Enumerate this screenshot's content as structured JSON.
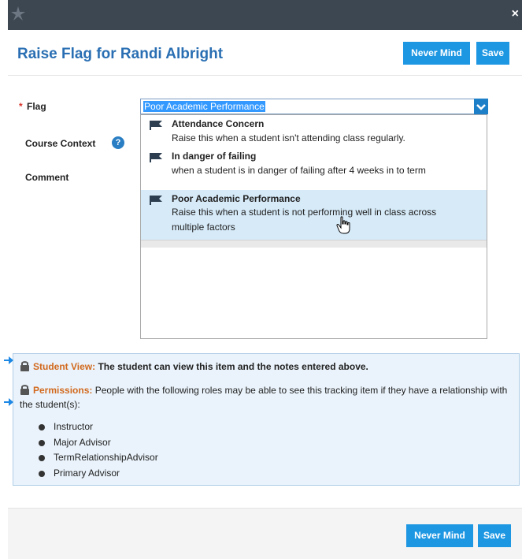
{
  "titlebar": {
    "close_label": "×"
  },
  "dialog": {
    "title": "Raise Flag for Randi Albright",
    "never_mind_label": "Never Mind",
    "save_label": "Save"
  },
  "form": {
    "required_marker": "*",
    "flag_label": "Flag",
    "course_context_label": "Course Context",
    "help_glyph": "?",
    "comment_label": "Comment",
    "flag_selected": "Poor Academic Performance"
  },
  "flag_options": [
    {
      "name": "Attendance Concern",
      "description": "Raise this when a student isn't attending class regularly."
    },
    {
      "name": "In danger of failing",
      "description": "when a student is in danger of failing after 4 weeks in to term"
    },
    {
      "name": "Poor Academic Performance",
      "description": "Raise this when a student is not performing well in class across",
      "description_line2": "multiple factors"
    }
  ],
  "info": {
    "student_view_label": "Student View:",
    "student_view_text": "The student can view this item and the notes entered above.",
    "permissions_label": "Permissions:",
    "permissions_text": "People with the following roles may be able to see this tracking item if they have a relationship with the student(s):",
    "roles": [
      "Instructor",
      "Major Advisor",
      "TermRelationshipAdvisor",
      "Primary Advisor"
    ]
  },
  "footer": {
    "never_mind_label": "Never Mind",
    "save_label": "Save"
  },
  "colors": {
    "accent": "#1e97e3",
    "title": "#2a6fb3",
    "titlebar": "#3d4752",
    "warning": "#d2691e",
    "selection": "#d6eaf8"
  },
  "icons": [
    "app-logo-icon",
    "close-icon",
    "chevron-down-icon",
    "flag-icon",
    "help-icon",
    "lock-icon",
    "arrow-right-icon",
    "hand-pointer-icon"
  ]
}
